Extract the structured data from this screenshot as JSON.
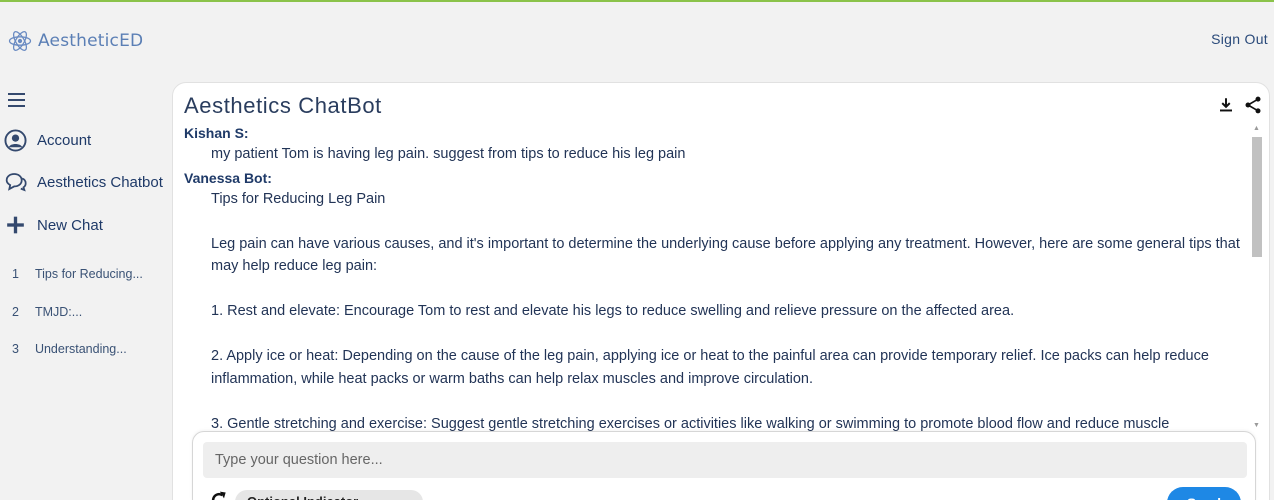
{
  "app": {
    "brand": "AestheticED",
    "sign_out": "Sign Out"
  },
  "sidebar": {
    "menu": [
      {
        "label": "Account",
        "icon": "user-circle-icon"
      },
      {
        "label": "Aesthetics Chatbot",
        "icon": "chat-bubbles-icon"
      },
      {
        "label": "New Chat",
        "icon": "plus-icon"
      }
    ],
    "history": [
      {
        "num": "1",
        "label": "Tips for Reducing..."
      },
      {
        "num": "2",
        "label": "TMJD:..."
      },
      {
        "num": "3",
        "label": "Understanding..."
      }
    ]
  },
  "main": {
    "title": "Aesthetics ChatBot",
    "messages": [
      {
        "speaker": "Kishan S:",
        "text": "my patient Tom is having leg pain. suggest from tips to reduce his leg pain"
      },
      {
        "speaker": "Vanessa Bot:",
        "text": "Tips for Reducing Leg Pain\n\nLeg pain can have various causes, and it's important to determine the underlying cause before applying any treatment. However, here are some general tips that may help reduce leg pain:\n\n1. Rest and elevate: Encourage Tom to rest and elevate his legs to reduce swelling and relieve pressure on the affected area.\n\n2. Apply ice or heat: Depending on the cause of the leg pain, applying ice or heat to the painful area can provide temporary relief. Ice packs can help reduce inflammation, while heat packs or warm baths can help relax muscles and improve circulation.\n\n3. Gentle stretching and exercise: Suggest gentle stretching exercises or activities like walking or swimming to promote blood flow and reduce muscle"
      }
    ]
  },
  "input": {
    "placeholder": "Type your question here...",
    "chip_label": "Optional Indicator",
    "send_label": "Send"
  },
  "colors": {
    "accent": "#1e88e5",
    "nav_text": "#1f3a68",
    "top_border": "#8bc34a"
  }
}
